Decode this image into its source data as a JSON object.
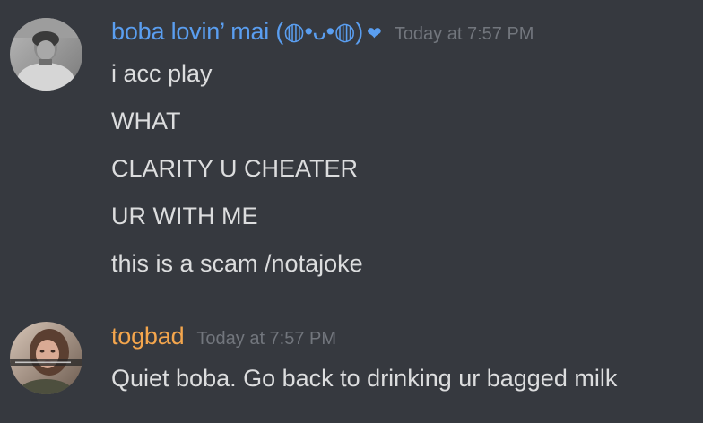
{
  "messages": [
    {
      "username": "boba lovin’ mai (◍•ᴗ•◍)",
      "badge": "❤",
      "timestamp": "Today at 7:57 PM",
      "lines": [
        "i acc play",
        "WHAT",
        "CLARITY U CHEATER",
        "UR WITH ME",
        "this is a scam /notajoke"
      ]
    },
    {
      "username": "togbad",
      "timestamp": "Today at 7:57 PM",
      "lines": [
        "Quiet boba. Go back to drinking ur bagged milk"
      ]
    }
  ],
  "colors": {
    "background": "#36393f",
    "username_1": "#5a9ef0",
    "username_2": "#f4a64d",
    "timestamp": "#72767d",
    "text": "#dcddde"
  }
}
